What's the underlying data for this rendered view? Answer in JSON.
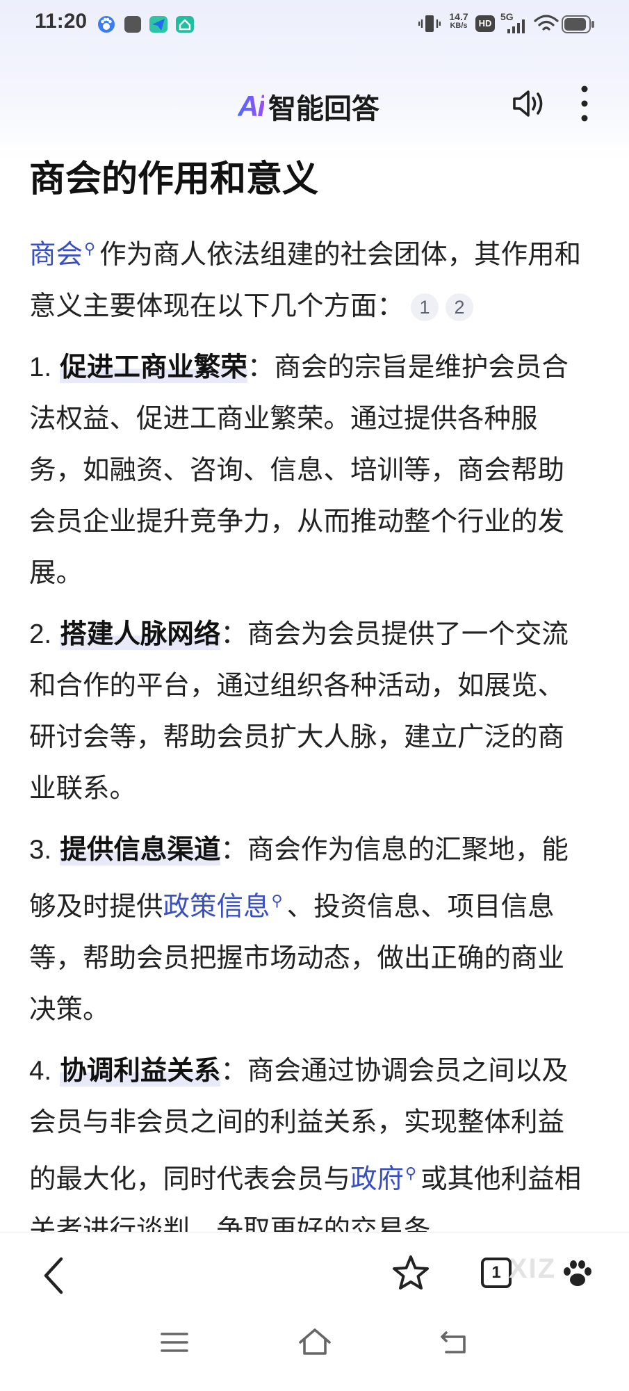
{
  "status_bar": {
    "time": "11:20",
    "network_speed": "14.7",
    "network_speed_unit": "KB/s",
    "hd_label": "HD",
    "signal_label": "5G"
  },
  "header": {
    "logo_ai": "Ai",
    "logo_text": "智能回答"
  },
  "article": {
    "title": "商会的作用和意义",
    "intro": {
      "link_text": "商会",
      "text": "作为商人依法组建的社会团体，其作用和意义主要体现在以下几个方面：",
      "citations": [
        "1",
        "2"
      ]
    },
    "points": [
      {
        "num": "1.",
        "heading": "促进工商业繁荣",
        "sep": "：",
        "body": "商会的宗旨是维护会员合法权益、促进工商业繁荣。通过提供各种服务，如融资、咨询、信息、培训等，商会帮助会员企业提升竞争力，从而推动整个行业的发展。"
      },
      {
        "num": "2.",
        "heading": "搭建人脉网络",
        "sep": "：",
        "body": "商会为会员提供了一个交流和合作的平台，通过组织各种活动，如展览、研讨会等，帮助会员扩大人脉，建立广泛的商业联系。"
      },
      {
        "num": "3.",
        "heading": "提供信息渠道",
        "sep": "：",
        "body_before": "商会作为信息的汇聚地，能够及时提供",
        "link_text": "政策信息",
        "body_after": "、投资信息、项目信息等，帮助会员把握市场动态，做出正确的商业决策。"
      },
      {
        "num": "4.",
        "heading": "协调利益关系",
        "sep": "：",
        "body_before": "商会通过协调会员之间以及会员与非会员之间的利益关系，实现整体利益的最大化，同时代表会员与",
        "link_text": "政府",
        "body_after": "或其他利益相关者进行谈判，争取更好的交易条"
      }
    ]
  },
  "bottom_nav": {
    "tab_count": "1",
    "watermark": "XIZ"
  },
  "colors": {
    "link": "#3a4fc1",
    "accent_start": "#4e6bff",
    "accent_end": "#9a4dff"
  }
}
